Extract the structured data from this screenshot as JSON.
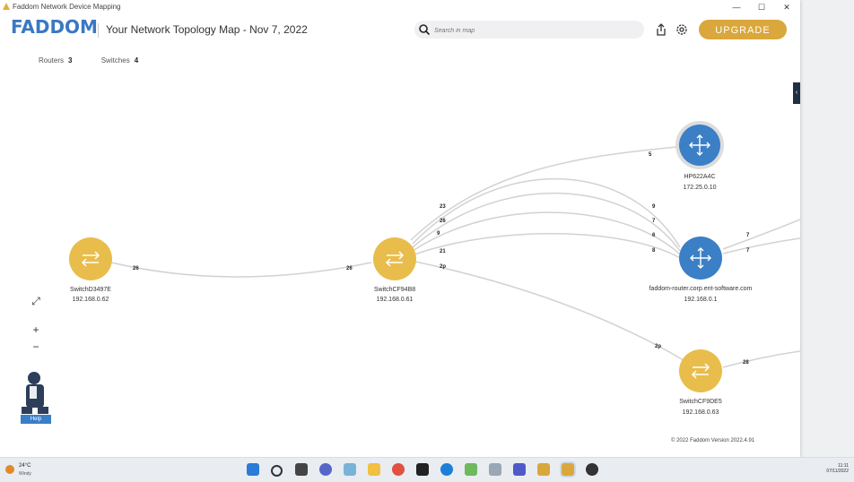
{
  "window": {
    "title": "Faddom Network Device Mapping",
    "controls": [
      "—",
      "☐",
      "✕"
    ]
  },
  "header": {
    "logo": "FADDOM",
    "title": "Your Network Topology Map - Nov 7, 2022",
    "search_placeholder": "Search in map",
    "upgrade_label": "UPGRADE"
  },
  "counts": {
    "routers_label": "Routers",
    "routers_value": "3",
    "switches_label": "Switches",
    "switches_value": "4"
  },
  "colors": {
    "router": "#3b7fc6",
    "switch": "#e8bd4b",
    "accent": "#d9a73c",
    "link": "#d2d2d2"
  },
  "nodes": [
    {
      "type": "switch",
      "name": "SwitchD3497E",
      "ip": "192.168.0.62"
    },
    {
      "type": "switch",
      "name": "SwitchCF94B8",
      "ip": "192.168.0.61"
    },
    {
      "type": "router",
      "name": "HP622A4C",
      "ip": "172.25.0.10"
    },
    {
      "type": "router",
      "name": "faddom-router.corp.ent-software.com",
      "ip": "192.168.0.1"
    },
    {
      "type": "switch",
      "name": "SwitchCF9DE5",
      "ip": "192.168.0.63"
    }
  ],
  "link_labels": [
    "26",
    "26",
    "23",
    "26",
    "9",
    "21",
    "2p",
    "5",
    "9",
    "7",
    "6",
    "8",
    "7",
    "7",
    "2p",
    "28"
  ],
  "zoom": {
    "fit": "⤢",
    "in": "+",
    "out": "−"
  },
  "help": {
    "label": "Help"
  },
  "footer": {
    "copyright": "© 2022 Faddom Version 2022.4.91"
  },
  "taskbar": {
    "temp": "24°C",
    "weather": "Windy",
    "time": "11:11",
    "date": "07/11/2022"
  }
}
